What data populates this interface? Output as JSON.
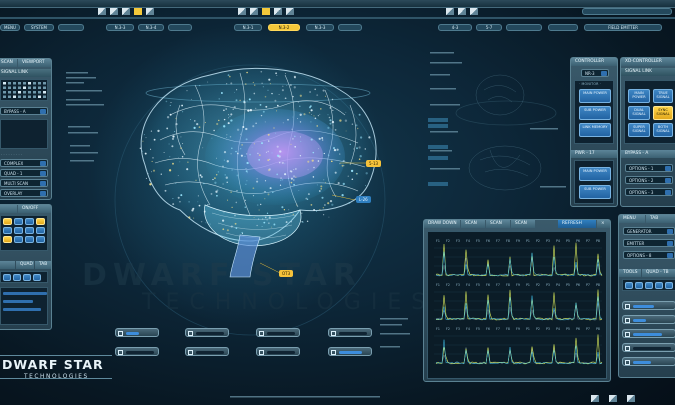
{
  "top_toolbar": {
    "menu_label": "MENU",
    "system_label": "SYSTEM",
    "group1": [
      "N.3-3",
      "N.3-4"
    ],
    "group2": [
      "N.3-1",
      "N.3-2",
      "N.3-3"
    ],
    "group3": [
      "4-3",
      "5-7"
    ],
    "field_emitter_label": "FIELD EMITTER"
  },
  "left_panel": {
    "scan_label": "SCAN",
    "viewport_label": "VIEWPORT",
    "signal_label": "SIGNAL LINK",
    "bypass_label": "BYPASS - A",
    "on_off_label": "ON/OFF",
    "quad_label": "QUAD",
    "tab_label": "TAB",
    "rows": [
      "COMPLEX",
      "QUAD - 1",
      "MULTI SCAN",
      "OVERLAY"
    ]
  },
  "hud": {
    "tag_left": "5-13",
    "tag_mid": "L-26",
    "tag_low": "OT3",
    "blur_text": "TECHNOLOGIES"
  },
  "logo": {
    "line1": "DWARF STAR",
    "line2": "TECHNOLOGIES"
  },
  "chart_panel": {
    "tabs": [
      "DRAW DOWN",
      "SCAN",
      "SCAN",
      "SCAN"
    ],
    "refresh_label": "REFRESH",
    "channel_labels": [
      "F1",
      "F2",
      "F3",
      "F4",
      "F5",
      "F6",
      "F7",
      "F8",
      "F9",
      "P1",
      "P2",
      "P3",
      "P4",
      "P5",
      "P6",
      "P7",
      "P8"
    ]
  },
  "controller_panel": {
    "controller_label": "CONTROLLER",
    "xcontroller_label": "XD-CONTROLLER",
    "tab_nr": "NR-3",
    "signal_label": "SIGNAL LINK",
    "section": "BYPASS - A",
    "buttons_col1": [
      "MAIN POWER",
      "SUB POWER",
      "LINK MEMORY"
    ],
    "buttons_col2": [
      "MAIN POWER",
      "DUAL SIGNAL",
      "SUPER SIGNAL"
    ],
    "buttons_col3": [
      "TRUE SIGNAL",
      "SYNC SIGNAL",
      "BOTH SIGNAL"
    ],
    "pwr_label": "PWR - 17",
    "buttons_low": [
      "MAIN POWER",
      "SUB POWER"
    ],
    "options": [
      "OPTIONS - 1",
      "OPTIONS - 2",
      "OPTIONS - 3"
    ]
  },
  "right_lower_panel": {
    "menu_label": "MENU",
    "tab_label": "TAB",
    "rows": [
      "GENERATOR",
      "EMITTER",
      "OPTIONS - 8"
    ],
    "tools_label": "TOOLS",
    "tools_value": "QUAD - TB"
  },
  "colors": {
    "accent_blue": "#3d8ddc",
    "accent_yellow": "#f3c83a",
    "panel": "#3a5a6b",
    "background": "#0a1c29"
  }
}
